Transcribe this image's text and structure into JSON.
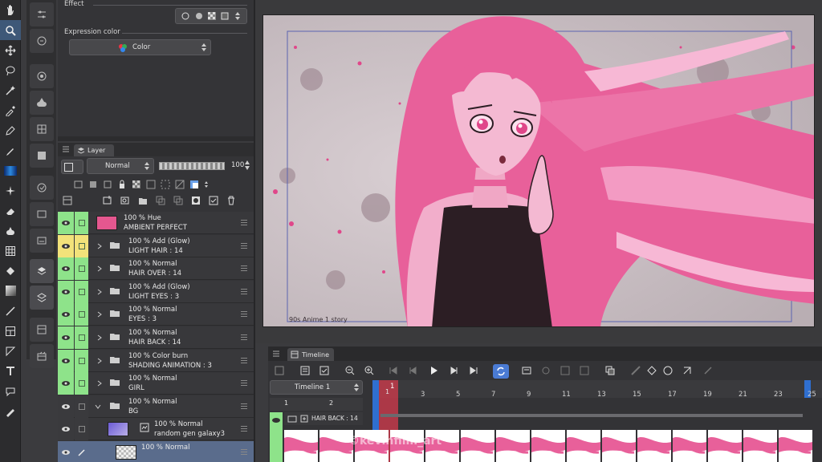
{
  "effect_section": {
    "title": "Effect",
    "expression_label": "Expression color",
    "color_value": "Color"
  },
  "layer_panel": {
    "tab_label": "Layer",
    "blend_mode": "Normal",
    "opacity": "100",
    "layers": [
      {
        "line1": "100 % Hue",
        "line2": "AMBIENT PERFECT",
        "kind": "color",
        "thumb": "#e5578f",
        "eye_bg": "#8ee38a",
        "lock_bg": "#8ee38a",
        "fold": false
      },
      {
        "line1": "100 % Add (Glow)",
        "line2": "LIGHT HAIR : 14",
        "kind": "folder",
        "eye_bg": "#f2e27a",
        "lock_bg": "#f2e27a",
        "fold": true
      },
      {
        "line1": "100 % Normal",
        "line2": "HAIR OVER : 14",
        "kind": "folder",
        "eye_bg": "#8ee38a",
        "lock_bg": "#8ee38a",
        "fold": true
      },
      {
        "line1": "100 % Add (Glow)",
        "line2": "LIGHT EYES : 3",
        "kind": "folder",
        "eye_bg": "#8ee38a",
        "lock_bg": "#8ee38a",
        "fold": true
      },
      {
        "line1": "100 % Normal",
        "line2": "EYES : 3",
        "kind": "folder",
        "eye_bg": "#8ee38a",
        "lock_bg": "#8ee38a",
        "fold": true
      },
      {
        "line1": "100 % Normal",
        "line2": "HAIR BACK : 14",
        "kind": "folder",
        "eye_bg": "#8ee38a",
        "lock_bg": "#8ee38a",
        "fold": true
      },
      {
        "line1": "100 % Color burn",
        "line2": "SHADING ANIMATION : 3",
        "kind": "folder",
        "eye_bg": "#8ee38a",
        "lock_bg": "#8ee38a",
        "fold": true
      },
      {
        "line1": "100 % Normal",
        "line2": "GIRL",
        "kind": "folder",
        "eye_bg": "#8ee38a",
        "lock_bg": "#8ee38a",
        "fold": true
      },
      {
        "line1": "100 % Normal",
        "line2": "BG",
        "kind": "folder-open",
        "eye_bg": "#3a3a3d",
        "lock_bg": "#3a3a3d",
        "fold": true
      },
      {
        "line1": "100 % Normal",
        "line2": "random gen galaxy3",
        "kind": "image",
        "eye_bg": "#3a3a3d",
        "lock_bg": "#3a3a3d",
        "fold": false
      },
      {
        "line1": "100 % Normal",
        "line2": "",
        "kind": "image-selected",
        "eye_bg": "#5a6c8c",
        "lock_bg": "#5a6c8c",
        "fold": false
      }
    ]
  },
  "canvas": {
    "caption": "90s Anime 1 story"
  },
  "timeline": {
    "tab_label": "Timeline",
    "selector": "Timeline 1",
    "frame_numbers": [
      "1",
      "3",
      "5",
      "7",
      "9",
      "11",
      "13",
      "15",
      "17",
      "19",
      "21",
      "23",
      "25"
    ],
    "small_frames": [
      "1",
      "2"
    ],
    "track_label": "HAIR BACK : 14",
    "current_frame": "1",
    "watermark": "©kevinfilm_art"
  },
  "colors": {
    "accent": "#4a7bd4",
    "active_tool": "#3e5878",
    "green": "#8ee38a",
    "yellow": "#f2e27a",
    "pink": "#e5578f",
    "playhead": "#c23a4a"
  }
}
